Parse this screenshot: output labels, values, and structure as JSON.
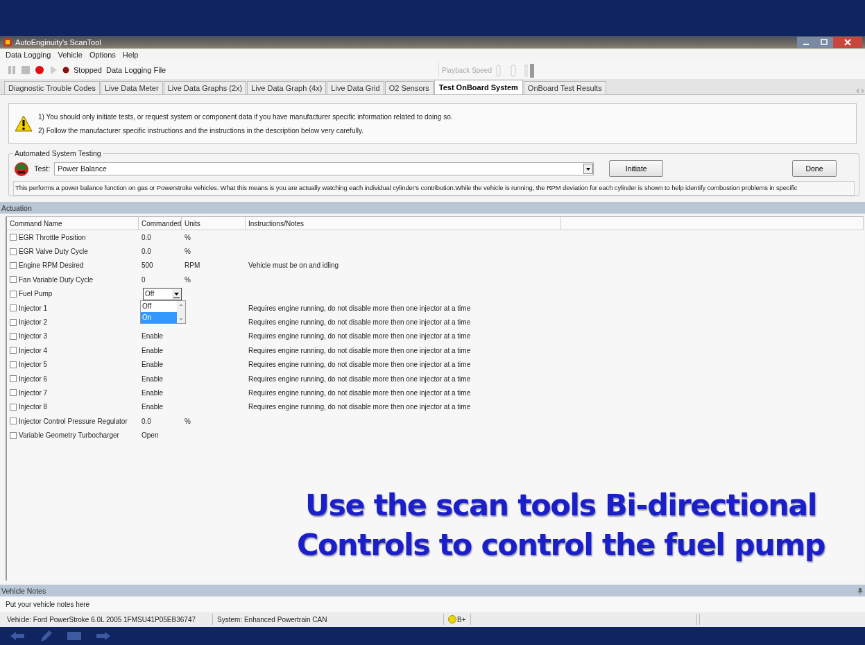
{
  "window": {
    "title": "AutoEnginuity's ScanTool"
  },
  "menu": [
    "Data Logging",
    "Vehicle",
    "Options",
    "Help"
  ],
  "toolbar": {
    "status": "Stopped",
    "file_label": "Data Logging File",
    "playback_label": "Playback Speed"
  },
  "tabs": [
    {
      "label": "Diagnostic Trouble Codes",
      "selected": false
    },
    {
      "label": "Live Data Meter",
      "selected": false
    },
    {
      "label": "Live Data Graphs (2x)",
      "selected": false
    },
    {
      "label": "Live Data Graph (4x)",
      "selected": false
    },
    {
      "label": "Live Data Grid",
      "selected": false
    },
    {
      "label": "O2 Sensors",
      "selected": false
    },
    {
      "label": "Test OnBoard System",
      "selected": true
    },
    {
      "label": "OnBoard Test Results",
      "selected": false
    }
  ],
  "warning": {
    "lines": [
      "1) You should only initiate tests, or request system or component data if you have manufacturer specific information related to doing so.",
      "2) Follow the manufacturer specific instructions and the instructions in the description below very carefully."
    ]
  },
  "test_group": {
    "title": "Automated System Testing",
    "test_label": "Test:",
    "test_value": "Power Balance",
    "initiate_button": "Initiate",
    "done_button": "Done",
    "description": "This performs a power balance function on gas or Powerstroke vehicles. What this means is you are actually watching each individual cylinder's contribution.While the vehicle is running, the RPM deviation for each cylinder is shown to help identify combustion problems in specific"
  },
  "actuation": {
    "title": "Actuation",
    "columns": [
      "Command Name",
      "Commanded",
      "Units",
      "Instructions/Notes"
    ],
    "rows": [
      {
        "kind": "text",
        "name": "EGR Throttle Position",
        "checked": false,
        "commanded": "0.0",
        "units": "%"
      },
      {
        "kind": "text",
        "name": "EGR Valve Duty Cycle",
        "checked": false,
        "commanded": "0.0",
        "units": "%"
      },
      {
        "kind": "text",
        "name": "Engine RPM Desired",
        "checked": false,
        "commanded": "500",
        "units": "RPM",
        "notes": "Vehicle must be on and idling"
      },
      {
        "kind": "text",
        "name": "Fan Variable Duty Cycle",
        "checked": false,
        "commanded": "0",
        "units": "%"
      },
      {
        "kind": "dropdown",
        "name": "Fuel Pump",
        "checked": false,
        "commanded": "Off",
        "options": [
          {
            "label": "Off",
            "selected": false
          },
          {
            "label": "On",
            "selected": true
          }
        ]
      },
      {
        "kind": "text",
        "name": "Injector 1",
        "checked": false,
        "notes": "Requires engine running, do not disable more then one injector at a time"
      },
      {
        "kind": "text",
        "name": "Injector 2",
        "checked": false,
        "notes": "Requires engine running, do not disable more then one injector at a time"
      },
      {
        "kind": "text",
        "name": "Injector 3",
        "checked": false,
        "commanded": "Enable",
        "notes": "Requires engine running, do not disable more then one injector at a time"
      },
      {
        "kind": "text",
        "name": "Injector 4",
        "checked": false,
        "commanded": "Enable",
        "notes": "Requires engine running, do not disable more then one injector at a time"
      },
      {
        "kind": "text",
        "name": "Injector 5",
        "checked": false,
        "commanded": "Enable",
        "notes": "Requires engine running, do not disable more then one injector at a time"
      },
      {
        "kind": "text",
        "name": "Injector 6",
        "checked": false,
        "commanded": "Enable",
        "notes": "Requires engine running, do not disable more then one injector at a time"
      },
      {
        "kind": "text",
        "name": "Injector 7",
        "checked": false,
        "commanded": "Enable",
        "notes": "Requires engine running, do not disable more then one injector at a time"
      },
      {
        "kind": "text",
        "name": "Injector 8",
        "checked": false,
        "commanded": "Enable",
        "notes": "Requires engine running, do not disable more then one injector at a time"
      },
      {
        "kind": "text",
        "name": "Injector Control Pressure Regulator",
        "checked": false,
        "commanded": "0.0",
        "units": "%"
      },
      {
        "kind": "text",
        "name": "Variable Geometry Turbocharger",
        "checked": false,
        "commanded": "Open"
      }
    ]
  },
  "caption": [
    "Use the scan tools Bi-directional",
    "Controls to control the fuel pump"
  ],
  "vehicle_notes": {
    "title": "Vehicle Notes",
    "text": "Put your vehicle notes here"
  },
  "status_bar": {
    "vehicle": "Vehicle: Ford  PowerStroke 6.0L  2005  1FMSU41P05EB36747",
    "system": "System: Enhanced Powertrain CAN",
    "battery": "B+"
  }
}
